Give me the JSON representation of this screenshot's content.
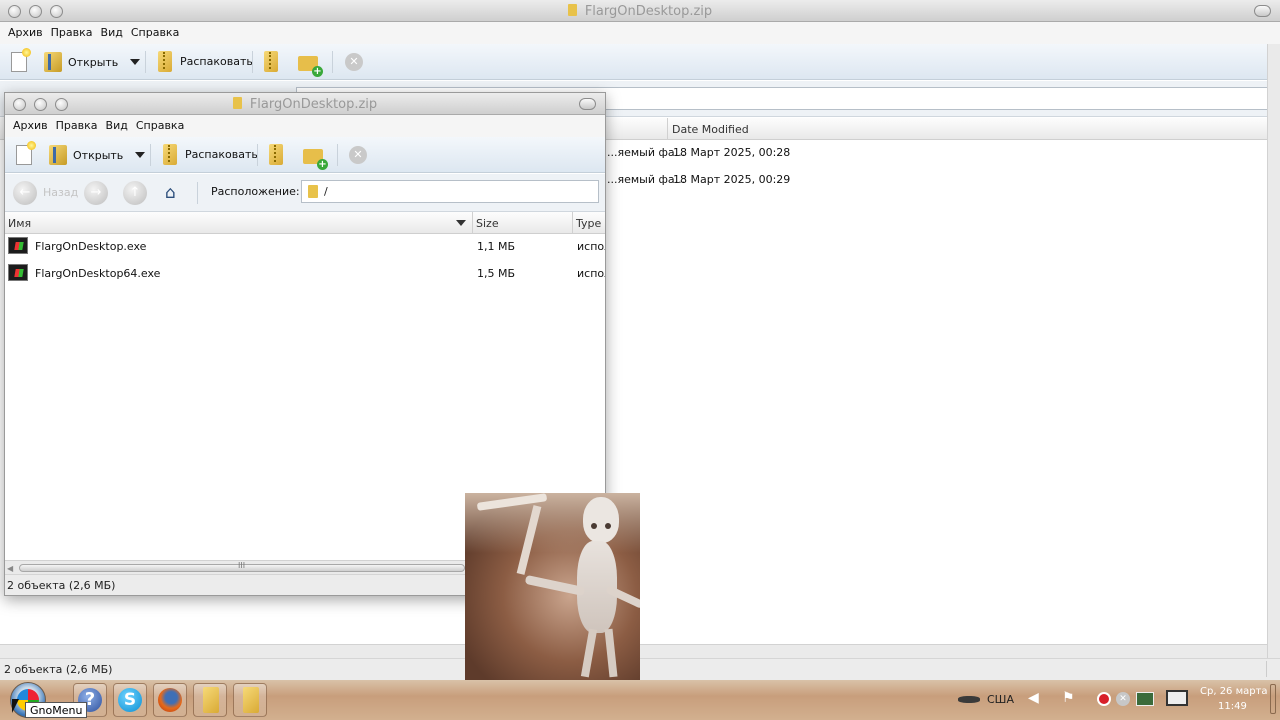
{
  "back_window": {
    "title": "FlargOnDesktop.zip",
    "menu": [
      "Архив",
      "Правка",
      "Вид",
      "Справка"
    ],
    "toolbar": {
      "open_label": "Открыть",
      "extract_label": "Распаковать"
    },
    "columns": {
      "date_modified": "Date Modified"
    },
    "rows": [
      {
        "type": "...яемый фа...",
        "date": "18 Март 2025, 00:28"
      },
      {
        "type": "...яемый фа...",
        "date": "18 Март 2025, 00:29"
      }
    ],
    "status": "2 объекта (2,6 МБ)"
  },
  "front_window": {
    "title": "FlargOnDesktop.zip",
    "menu": [
      "Архив",
      "Правка",
      "Вид",
      "Справка"
    ],
    "toolbar": {
      "open_label": "Открыть",
      "extract_label": "Распаковать"
    },
    "nav": {
      "back_label": "Назад",
      "location_label": "Расположение:",
      "location_value": "/"
    },
    "columns": {
      "name": "Имя",
      "size": "Size",
      "type": "Type"
    },
    "files": [
      {
        "name": "FlargOnDesktop.exe",
        "size": "1,1 МБ",
        "type": "испол"
      },
      {
        "name": "FlargOnDesktop64.exe",
        "size": "1,5 МБ",
        "type": "испол"
      }
    ],
    "scroll_grip": "III",
    "status": "2 объекта (2,6 МБ)"
  },
  "taskbar": {
    "start_tooltip": "GnoMenu",
    "tray": {
      "keyboard_layout": "США",
      "date": "Ср, 26 марта",
      "time": "11:49"
    }
  },
  "icons": {
    "start": "start-orb-icon",
    "help": "help-icon",
    "skype": "skype-icon",
    "firefox": "firefox-icon",
    "archive_manager": "archive-manager-icon"
  }
}
